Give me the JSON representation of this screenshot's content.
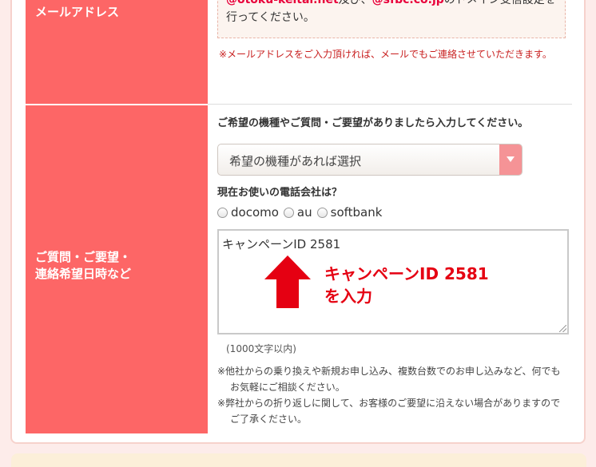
{
  "email_section": {
    "label": "メールアドレス",
    "domain_text": {
      "domain1": "@otoku-keitai.net",
      "mid": "及び、",
      "domain2": "@sfbc.co.jp",
      "tail": "のドメイン受信設定を",
      "line2": "行ってください。"
    },
    "note": "※メールアドレスをご入力頂ければ、メールでもご連絡させていただきます。"
  },
  "inquiry_section": {
    "label_line1": "ご質問・ご要望・",
    "label_line2": "連絡希望日時など",
    "intro": "ご希望の機種やご質問・ご要望がありましたら入力してください。",
    "model_select": {
      "selected": "希望の機種があれば選択"
    },
    "phone_question": "現在お使いの電話会社は？",
    "carriers": [
      "docomo",
      "au",
      "softbank"
    ],
    "textarea_value": "キャンペーンID 2581",
    "callout_line1": "キャンペーンID 2581",
    "callout_line2": "を入力",
    "limit": "(1000文字以内)",
    "notes": [
      "※他社からの乗り換えや新規お申し込み、複数台数でのお申し込みなど、何でもお気軽にご相談ください。",
      "※弊社からの折り返しに関して、お客様のご要望に沿えない場合がありますのでご了承ください。"
    ]
  },
  "colors": {
    "label_bg": "#fd6666",
    "select_arrow": "#f59396",
    "callout": "#e50012"
  }
}
